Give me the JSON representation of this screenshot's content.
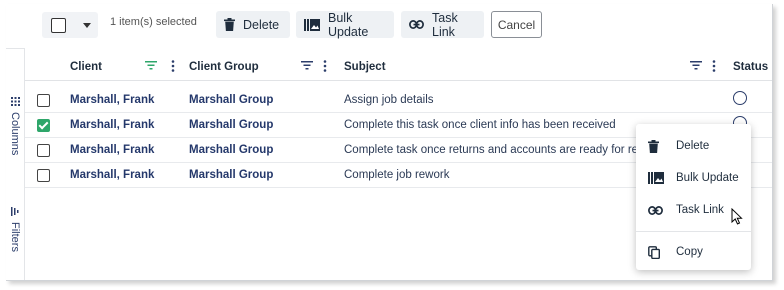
{
  "toolbar": {
    "selection_text": "1 item(s) selected",
    "delete_label": "Delete",
    "bulk_update_label": "Bulk Update",
    "task_link_label": "Task Link",
    "cancel_label": "Cancel"
  },
  "side_rail": {
    "columns_label": "Columns",
    "filters_label": "Filters"
  },
  "grid": {
    "columns": [
      "Client",
      "Client Group",
      "Subject",
      "Status"
    ],
    "rows": [
      {
        "client": "Marshall, Frank",
        "group": "Marshall Group",
        "subject": "Assign job details",
        "checked": false
      },
      {
        "client": "Marshall, Frank",
        "group": "Marshall Group",
        "subject": "Complete this task once client info has been received",
        "checked": true
      },
      {
        "client": "Marshall, Frank",
        "group": "Marshall Group",
        "subject": "Complete task once returns and accounts are ready for revie",
        "checked": false
      },
      {
        "client": "Marshall, Frank",
        "group": "Marshall Group",
        "subject": "Complete job rework",
        "checked": false
      }
    ]
  },
  "context_menu": {
    "delete": "Delete",
    "bulk_update": "Bulk Update",
    "task_link": "Task Link",
    "copy": "Copy"
  },
  "colors": {
    "accent_green": "#2ea66a",
    "link_navy": "#24386b"
  }
}
